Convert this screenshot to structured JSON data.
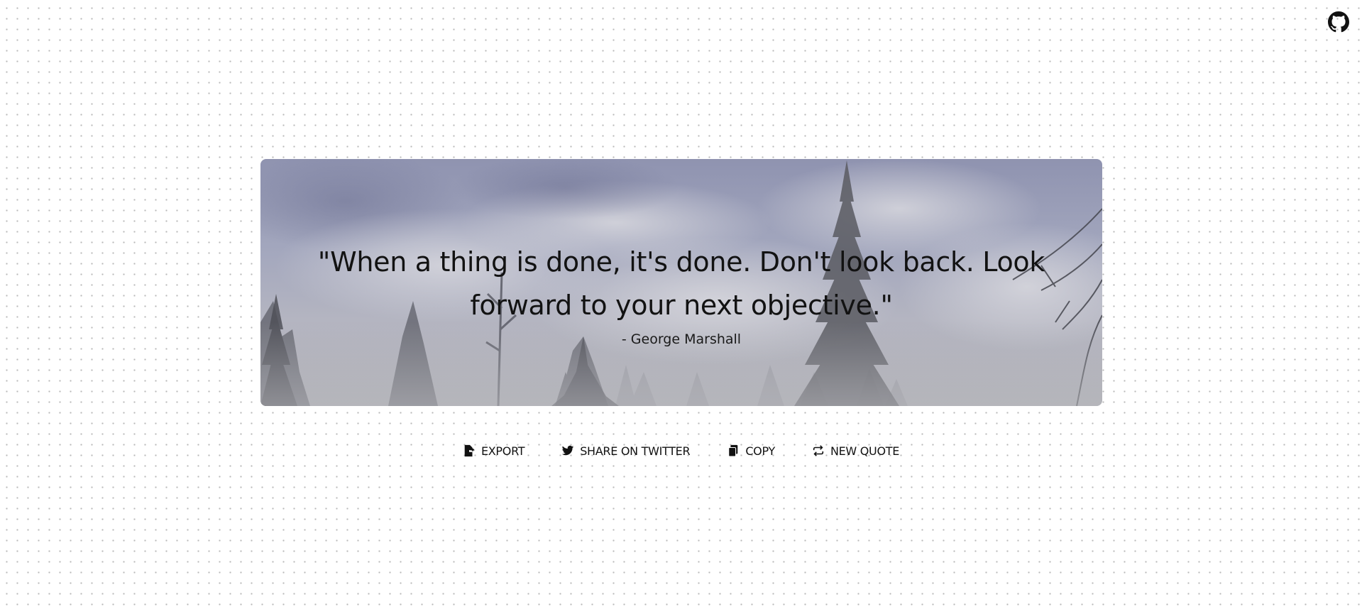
{
  "header": {
    "github_icon": "github-icon"
  },
  "quote_card": {
    "text": "\"When a thing is done, it's done. Don't look back. Look forward to your next objective.\"",
    "author": "- George Marshall",
    "background": "misty-forest-image"
  },
  "actions": {
    "export": {
      "label": "EXPORT",
      "icon": "file-export-icon"
    },
    "twitter": {
      "label": "SHARE ON TWITTER",
      "icon": "twitter-icon"
    },
    "copy": {
      "label": "COPY",
      "icon": "copy-icon"
    },
    "new_quote": {
      "label": "NEW QUOTE",
      "icon": "repeat-icon"
    }
  },
  "colors": {
    "text": "#121212",
    "dots": "#b9b9b9",
    "card_sky": "#9a9db8"
  }
}
